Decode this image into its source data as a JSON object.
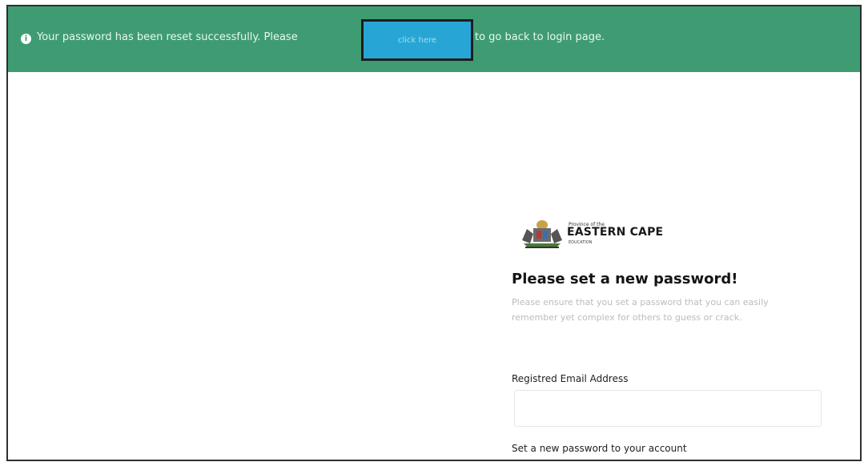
{
  "alert": {
    "icon": "info-icon",
    "color": "#3f9c72",
    "message_start": "Your password has been reset successfully. Please",
    "button_label": "click here",
    "button_color": "#27a6d6",
    "message_end": "to go back to login page."
  },
  "logo": {
    "line_small": "Province of the",
    "name": "EASTERN CAPE",
    "line_sub": "EDUCATION"
  },
  "form": {
    "title": "Please set a new password!",
    "description": "Please ensure that you set a password that you can easily remember yet complex for others to guess or crack.",
    "email_label": "Registred Email Address",
    "email_value": "",
    "password_label": "Set a new password to your account"
  }
}
